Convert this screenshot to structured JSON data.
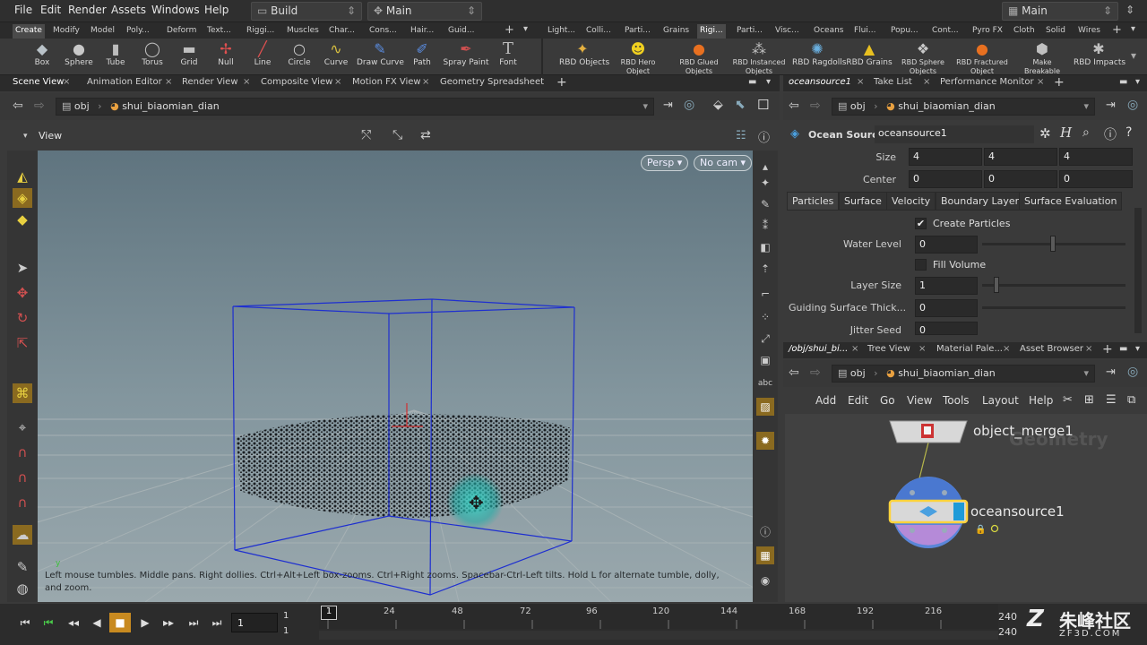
{
  "menu": {
    "items": [
      "File",
      "Edit",
      "Render",
      "Assets",
      "Windows",
      "Help"
    ],
    "desktop_build": "Build",
    "desktop_main": "Main",
    "desktop_right": "Main"
  },
  "shelf_tabs_left": [
    "Create",
    "Modify",
    "Model",
    "Poly...",
    "Deform",
    "Text...",
    "Riggi...",
    "Muscles",
    "Char...",
    "Cons...",
    "Hair...",
    "Guid..."
  ],
  "shelf_tabs_right": [
    "Light...",
    "Colli...",
    "Parti...",
    "Grains",
    "Rigi...",
    "Parti...",
    "Visc...",
    "Oceans",
    "Flui...",
    "Popu...",
    "Cont...",
    "Pyro FX",
    "Cloth",
    "Solid",
    "Wires"
  ],
  "tools_left": [
    {
      "label": "Box",
      "icon": "box-icon"
    },
    {
      "label": "Sphere",
      "icon": "sphere-icon"
    },
    {
      "label": "Tube",
      "icon": "tube-icon"
    },
    {
      "label": "Torus",
      "icon": "torus-icon"
    },
    {
      "label": "Grid",
      "icon": "grid-icon"
    },
    {
      "label": "Null",
      "icon": "null-icon"
    },
    {
      "label": "Line",
      "icon": "line-icon"
    },
    {
      "label": "Circle",
      "icon": "circle-icon"
    },
    {
      "label": "Curve",
      "icon": "curve-icon"
    },
    {
      "label": "Draw Curve",
      "icon": "draw-curve-icon"
    },
    {
      "label": "Path",
      "icon": "path-icon"
    },
    {
      "label": "Spray Paint",
      "icon": "spray-paint-icon"
    },
    {
      "label": "Font",
      "icon": "font-icon"
    }
  ],
  "tools_right": [
    {
      "label": "RBD Objects"
    },
    {
      "label": "RBD Hero Object"
    },
    {
      "label": "RBD Glued Objects"
    },
    {
      "label": "RBD Instanced Objects"
    },
    {
      "label": "RBD Ragdolls"
    },
    {
      "label": "RBD Grains"
    },
    {
      "label": "RBD Sphere Objects"
    },
    {
      "label": "RBD Fractured Object"
    },
    {
      "label": "Make Breakable"
    },
    {
      "label": "RBD Impacts"
    }
  ],
  "left_tabs": [
    "Scene View",
    "Animation Editor",
    "Render View",
    "Composite View",
    "Motion FX View",
    "Geometry Spreadsheet"
  ],
  "path": {
    "root": "obj",
    "node": "shui_biaomian_dian"
  },
  "viewport": {
    "title": "View",
    "persp": "Persp",
    "cam": "No cam",
    "hint": "Left mouse tumbles. Middle pans. Right dollies. Ctrl+Alt+Left box-zooms. Ctrl+Right zooms. Spacebar-Ctrl-Left tilts. Hold L for alternate tumble, dolly, and zoom.",
    "axis_label": "y"
  },
  "params_tabs": [
    "oceansource1",
    "Take List",
    "Performance Monitor"
  ],
  "params": {
    "node_type": "Ocean Source",
    "node_name": "oceansource1",
    "size_label": "Size",
    "size": [
      "4",
      "4",
      "4"
    ],
    "center_label": "Center",
    "center": [
      "0",
      "0",
      "0"
    ],
    "subtabs": [
      "Particles",
      "Surface",
      "Velocity",
      "Boundary Layer",
      "Surface Evaluation"
    ],
    "create_particles": "Create Particles",
    "water_level_label": "Water Level",
    "water_level": "0",
    "fill_volume": "Fill Volume",
    "layer_size_label": "Layer Size",
    "layer_size": "1",
    "guiding_label": "Guiding Surface Thick...",
    "guiding": "0",
    "jitter_label": "Jitter Seed",
    "jitter": "0"
  },
  "net_tabs": [
    "/obj/shui_bi...",
    "Tree View",
    "Material Pale...",
    "Asset Browser"
  ],
  "net_menu": [
    "Add",
    "Edit",
    "Go",
    "View",
    "Tools",
    "Layout",
    "Help"
  ],
  "nodes": {
    "merge": "object_merge1",
    "ocean": "oceansource1",
    "watermark": "Geometry"
  },
  "timeline": {
    "frame": "1",
    "start": "1",
    "start2": "1",
    "current_marker": "1",
    "ticks": [
      "24",
      "48",
      "72",
      "96",
      "120",
      "144",
      "168",
      "192",
      "216"
    ],
    "end": "240",
    "end2": "240"
  },
  "brand": {
    "cn": "朱峰社区",
    "url": "ZF3D.COM"
  },
  "colors": {
    "accent": "#f0a30a",
    "select": "#ffd23c",
    "bbox": "#1e2fd0"
  }
}
